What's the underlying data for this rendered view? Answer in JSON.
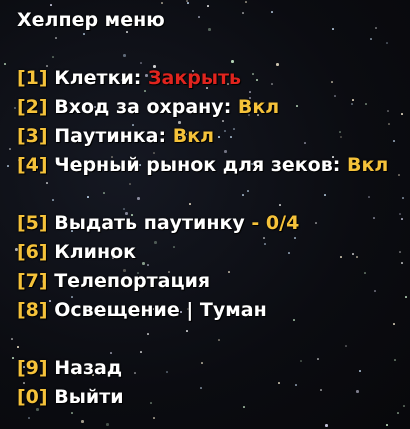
{
  "title": "Хелпер меню",
  "items": [
    {
      "num": "[1]",
      "label": "Клетки:",
      "value": "Закрыть",
      "value_color": "red"
    },
    {
      "num": "[2]",
      "label": "Вход за охрану:",
      "value": "Вкл",
      "value_color": "yellow"
    },
    {
      "num": "[3]",
      "label": "Паутинка:",
      "value": "Вкл",
      "value_color": "yellow"
    },
    {
      "num": "[4]",
      "label": "Черный рынок для зеков:",
      "value": "Вкл",
      "value_color": "yellow"
    },
    {
      "num": "[5]",
      "label": "Выдать паутинку",
      "sep": "-",
      "counter": "0/4"
    },
    {
      "num": "[6]",
      "label": "Клинок"
    },
    {
      "num": "[7]",
      "label": "Телепортация"
    },
    {
      "num": "[8]",
      "label": "Освещение | Туман"
    },
    {
      "num": "[9]",
      "label": "Назад"
    },
    {
      "num": "[0]",
      "label": "Выйти"
    }
  ],
  "colors": {
    "text": "#ffffff",
    "accent": "#f5c23a",
    "danger": "#e0241e",
    "background": "#0a0a0e"
  }
}
